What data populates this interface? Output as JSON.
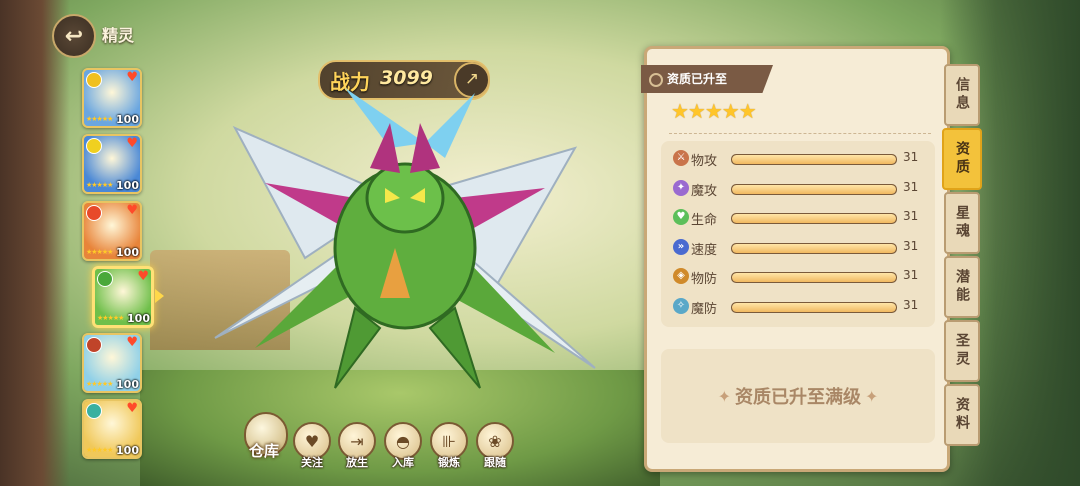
{
  "header": {
    "back_icon": "back-arrow-icon",
    "title": "精灵"
  },
  "pets": [
    {
      "level": "100",
      "stars": "★★★★★",
      "bg": "#6aa6e0",
      "elem": "#f0c020",
      "selected": false
    },
    {
      "level": "100",
      "stars": "★★★★★",
      "bg": "#4a88d6",
      "elem": "#f0d020",
      "selected": false
    },
    {
      "level": "100",
      "stars": "★★★★★",
      "bg": "#e8843a",
      "elem": "#e84a2a",
      "selected": false
    },
    {
      "level": "100",
      "stars": "★★★★★",
      "bg": "#6fbf4a",
      "elem": "#4aa83a",
      "selected": true
    },
    {
      "level": "100",
      "stars": "★★★★★",
      "bg": "#8fd0e8",
      "elem": "#c0442a",
      "selected": false
    },
    {
      "level": "100",
      "stars": "★★★★★",
      "bg": "#f0c85a",
      "elem": "#3ab0a0",
      "selected": false
    }
  ],
  "power": {
    "label": "战力",
    "value": "3099",
    "share_icon": "share-icon"
  },
  "actions": {
    "warehouse": "仓库",
    "items": [
      {
        "label": "关注",
        "icon": "heart-hand-icon",
        "glyph": "♥"
      },
      {
        "label": "放生",
        "icon": "door-exit-icon",
        "glyph": "⇥"
      },
      {
        "label": "入库",
        "icon": "capsule-icon",
        "glyph": "◓"
      },
      {
        "label": "锻炼",
        "icon": "dumbbell-icon",
        "glyph": "⊪"
      },
      {
        "label": "跟随",
        "icon": "paw-icon",
        "glyph": "❀"
      }
    ]
  },
  "panel": {
    "title": "资质已升至",
    "stars": "★★★★★",
    "stats": [
      {
        "name": "物攻",
        "value": "31",
        "icon": "sword-icon",
        "color": "#c9744a",
        "glyph": "⚔",
        "fill": 1.0
      },
      {
        "name": "魔攻",
        "value": "31",
        "icon": "magic-icon",
        "color": "#9a6ad0",
        "glyph": "✦",
        "fill": 1.0
      },
      {
        "name": "生命",
        "value": "31",
        "icon": "heart-icon",
        "color": "#5cbf5a",
        "glyph": "♥",
        "fill": 1.0
      },
      {
        "name": "速度",
        "value": "31",
        "icon": "speed-icon",
        "color": "#4a6ad0",
        "glyph": "»",
        "fill": 1.0
      },
      {
        "name": "物防",
        "value": "31",
        "icon": "shield-icon",
        "color": "#d08a2a",
        "glyph": "◈",
        "fill": 1.0
      },
      {
        "name": "魔防",
        "value": "31",
        "icon": "magic-shield-icon",
        "color": "#5aa8c8",
        "glyph": "✧",
        "fill": 1.0
      }
    ],
    "max_text": "资质已升至满级"
  },
  "tabs": [
    {
      "label": "信息",
      "active": false
    },
    {
      "label": "资质",
      "active": true
    },
    {
      "label": "星魂",
      "active": false
    },
    {
      "label": "潜能",
      "active": false
    },
    {
      "label": "圣灵",
      "active": false
    },
    {
      "label": "资料",
      "active": false
    }
  ]
}
